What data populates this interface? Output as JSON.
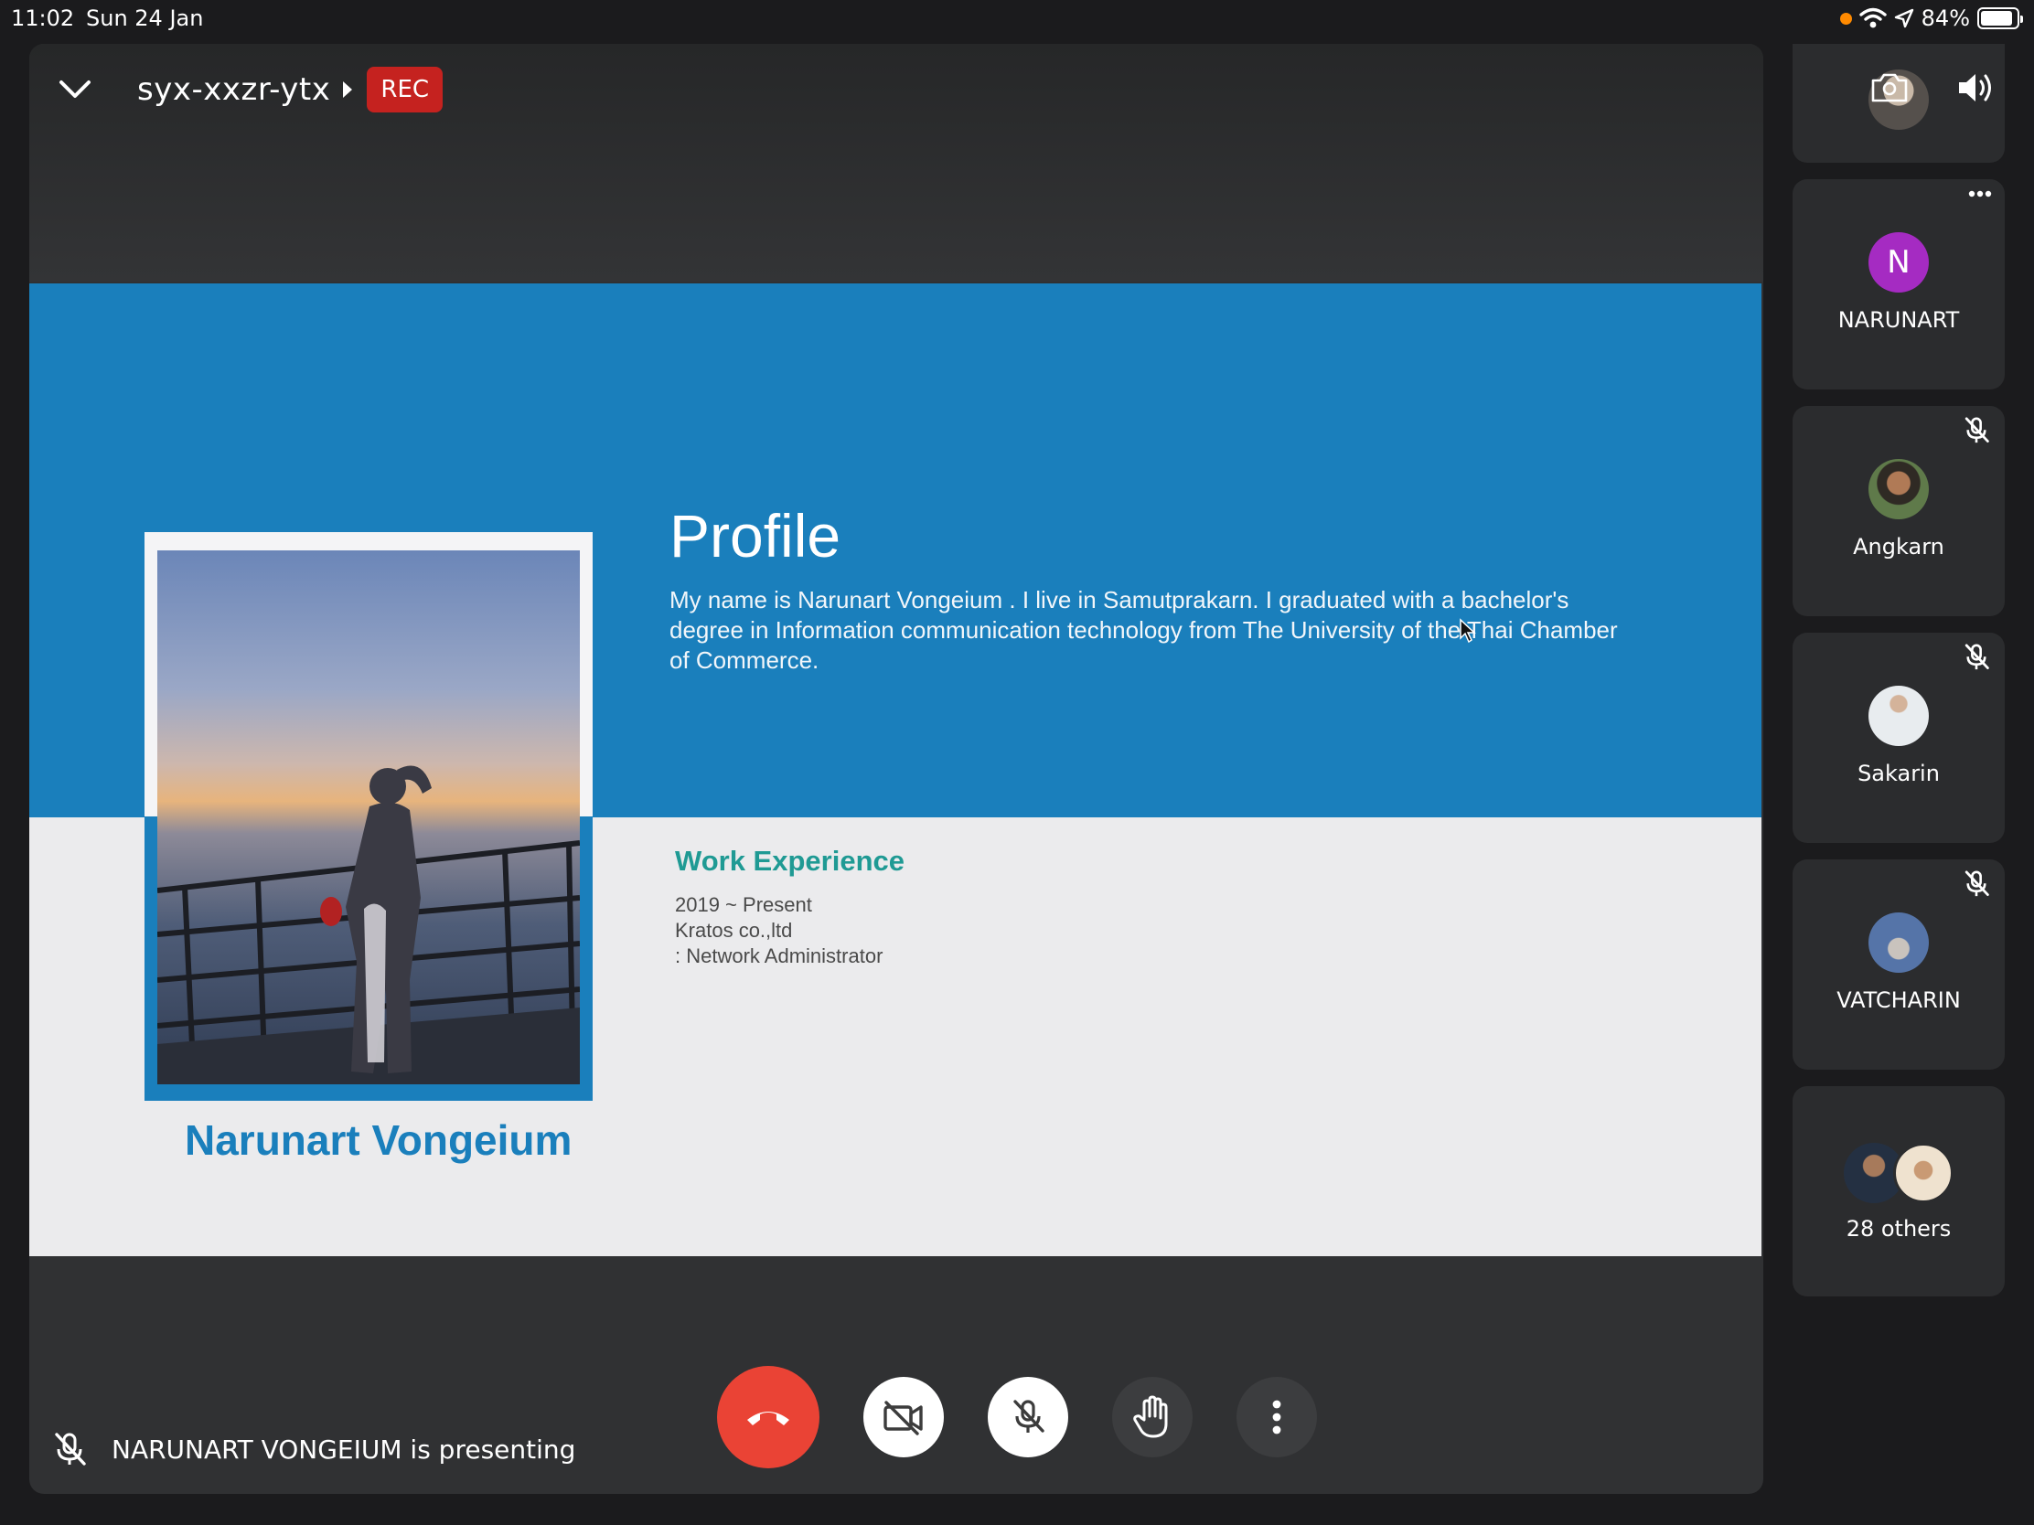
{
  "status_bar": {
    "time": "11:02",
    "date": "Sun 24 Jan",
    "battery": "84%"
  },
  "meeting": {
    "code": "syx-xxzr-ytx",
    "rec_label": "REC"
  },
  "slide": {
    "profile_title": "Profile",
    "profile_text": "My name is Narunart Vongeium . I live in Samutprakarn. I graduated with a bachelor's degree in Information communication technology from The University of the Thai Chamber of Commerce.",
    "name": "Narunart Vongeium",
    "work_title": "Work Experience",
    "work_lines": [
      "2019 ~ Present",
      "Kratos co.,ltd",
      ": Network Administrator"
    ]
  },
  "presenting_text": "NARUNART VONGEIUM is presenting",
  "participants": [
    {
      "name": "NARUNART",
      "initial": "N",
      "avatar_color": "#a52bc2"
    },
    {
      "name": "Angkarn"
    },
    {
      "name": "Sakarin"
    },
    {
      "name": "VATCHARIN"
    },
    {
      "name": "28 others"
    }
  ],
  "colors": {
    "end_call": "#ea4335",
    "rec": "#c5221f",
    "slide_blue": "#1a7fbc",
    "work_teal": "#1f9a94"
  }
}
